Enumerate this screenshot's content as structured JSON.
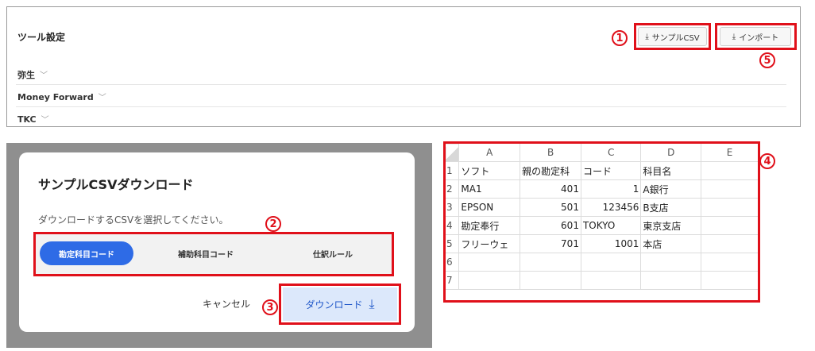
{
  "tool_settings": {
    "title": "ツール設定",
    "sections": [
      {
        "label": "弥生"
      },
      {
        "label": "Money Forward"
      },
      {
        "label": "TKC"
      }
    ],
    "sample_csv_button": "サンプルCSV",
    "import_button": "インポート"
  },
  "dialog": {
    "title": "サンプルCSVダウンロード",
    "description": "ダウンロードするCSVを選択してください。",
    "options": [
      "勘定科目コード",
      "補助科目コード",
      "仕訳ルール"
    ],
    "selected_option": "勘定科目コード",
    "cancel_label": "キャンセル",
    "download_label": "ダウンロード"
  },
  "spreadsheet": {
    "columns": [
      "A",
      "B",
      "C",
      "D",
      "E"
    ],
    "row_numbers": [
      "1",
      "2",
      "3",
      "4",
      "5",
      "6",
      "7"
    ],
    "rows": [
      [
        "ソフト",
        "親の勘定科",
        "コード",
        "科目名",
        ""
      ],
      [
        "MA1",
        "401",
        "1",
        "A銀行",
        ""
      ],
      [
        "EPSON",
        "501",
        "123456",
        "B支店",
        ""
      ],
      [
        "勘定奉行",
        "601",
        "TOKYO",
        "東京支店",
        ""
      ],
      [
        "フリーウェ",
        "701",
        "1001",
        "本店",
        ""
      ],
      [
        "",
        "",
        "",
        "",
        ""
      ],
      [
        "",
        "",
        "",
        "",
        ""
      ]
    ]
  },
  "annotations": [
    "1",
    "2",
    "3",
    "4",
    "5"
  ],
  "colors": {
    "highlight_red": "#e0101a",
    "primary_blue": "#2e6be6",
    "download_bg": "#dce8fb"
  }
}
